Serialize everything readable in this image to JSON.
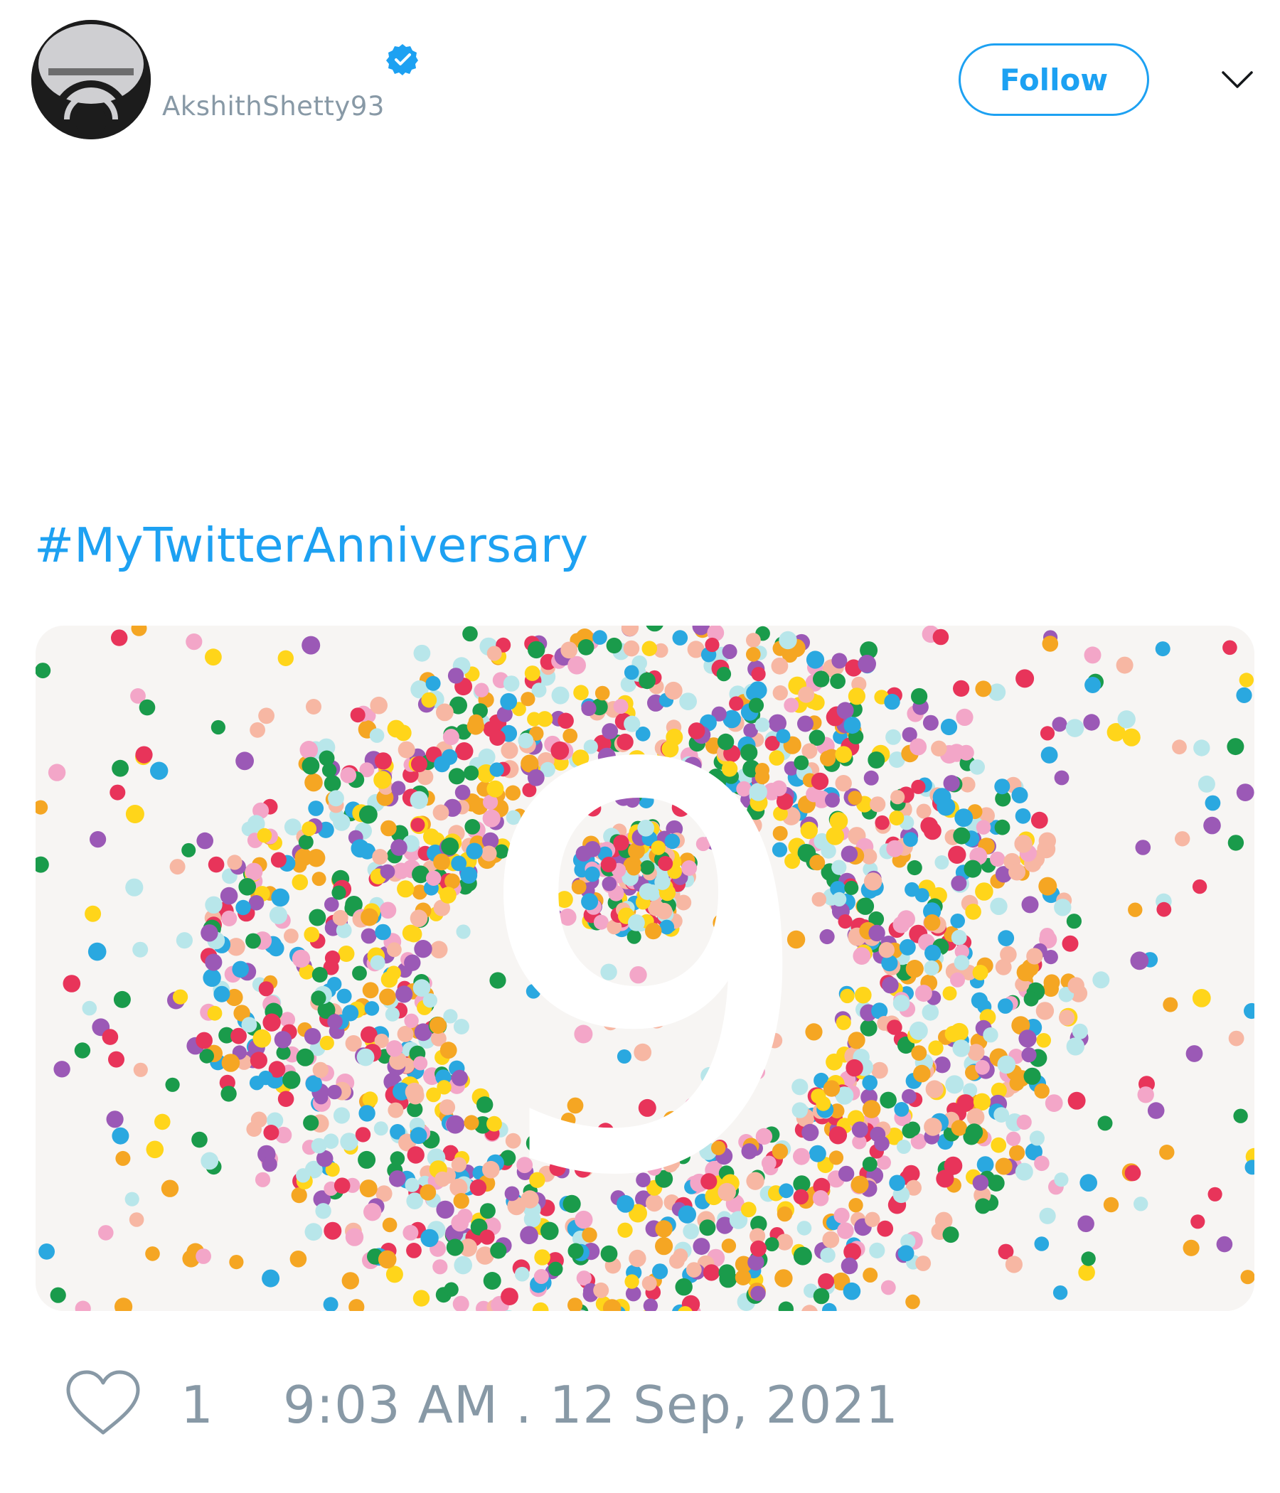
{
  "tweet": {
    "user": {
      "display_name": "",
      "handle": "AkshithShetty93",
      "verified": true,
      "avatar_icon": "profile-avatar"
    },
    "follow_label": "Follow",
    "menu_icon": "chevron-down-icon",
    "text": "",
    "hashtag": "#MyTwitterAnniversary",
    "media": {
      "kind": "image",
      "depicts": "confetti-number-9",
      "number_shown": "9"
    },
    "like_icon": "heart-icon",
    "like_count": "1",
    "timestamp": "9:03 AM . 12 Sep, 2021"
  },
  "colors": {
    "accent": "#1da1f2",
    "muted_text": "#8899a6",
    "confetti": [
      "#e8345a",
      "#f5a623",
      "#ffd51a",
      "#1a9b4b",
      "#2aa8e0",
      "#9b59b6",
      "#f7b7a3",
      "#b8e6ea",
      "#f3a6c8"
    ]
  }
}
